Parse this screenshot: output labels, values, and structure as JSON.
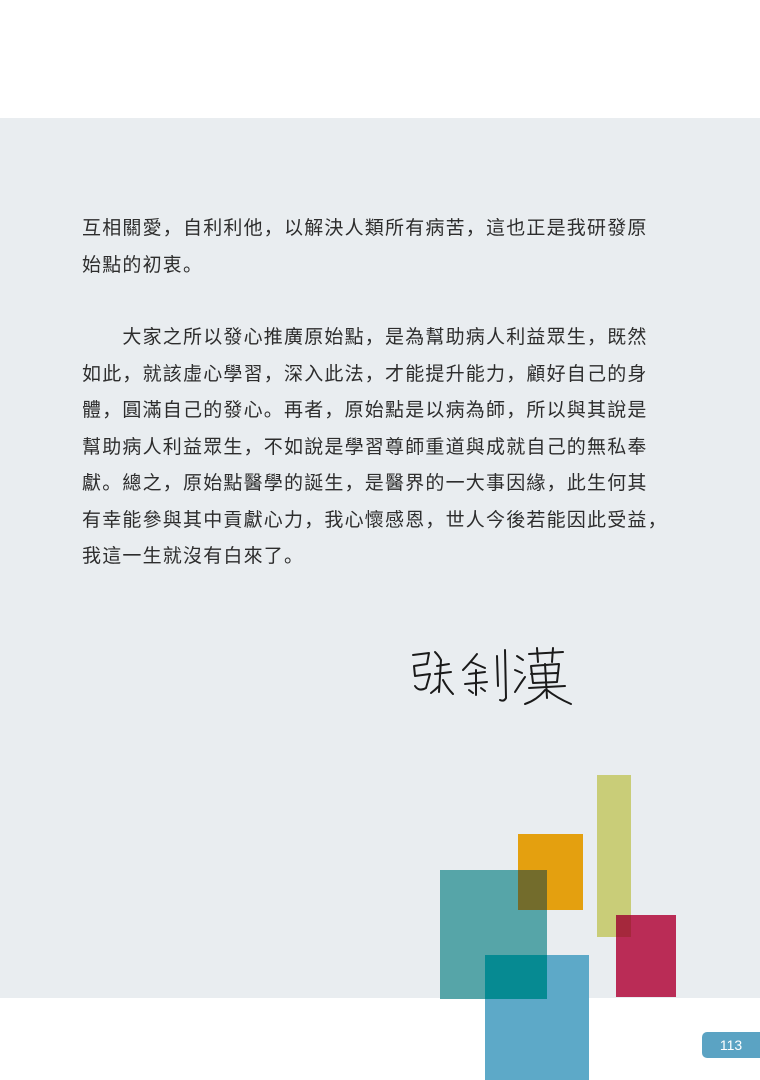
{
  "body": {
    "paragraphs": [
      "互相關愛，自利利他，以解決人類所有病苦，這也正是我研發原\n始點的初衷。",
      "　　大家之所以發心推廣原始點，是為幫助病人利益眾生，既然\n如此，就該虛心學習，深入此法，才能提升能力，顧好自己的身\n體，圓滿自己的發心。再者，原始點是以病為師，所以與其說是\n幫助病人利益眾生，不如說是學習尊師重道與成就自己的無私奉\n獻。總之，原始點醫學的誕生，是醫界的一大事因緣，此生何其\n有幸能參與其中貢獻心力，我心懷感恩，世人今後若能因此受益，\n我這一生就沒有白來了。"
    ]
  },
  "signature": {
    "text": "張釗漢"
  },
  "footer": {
    "page_number": "113"
  },
  "colors": {
    "panel": "#e9edf0",
    "olive": "#c9cd78",
    "orange": "#e4a00f",
    "teal": "#56a5a8",
    "blue": "#5da9c8",
    "red": "#ba2c56",
    "page_badge": "#5ba3c3"
  }
}
